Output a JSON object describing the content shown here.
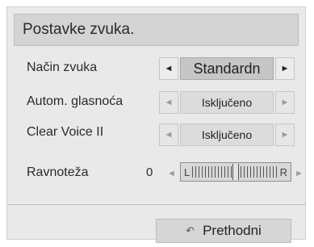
{
  "header": {
    "title": "Postavke zvuka."
  },
  "rows": [
    {
      "label": "Način zvuka",
      "value": "Standardn"
    },
    {
      "label": "Autom. glasnoća",
      "value": "Isključeno"
    },
    {
      "label": "Clear Voice II",
      "value": "Isključeno"
    }
  ],
  "balance": {
    "label": "Ravnoteža",
    "value": "0",
    "left": "L",
    "right": "R"
  },
  "footer": {
    "prev_label": "Prethodni"
  },
  "arrows": {
    "left": "◄",
    "right": "►"
  },
  "icons": {
    "prev": "return-arrow-icon"
  }
}
